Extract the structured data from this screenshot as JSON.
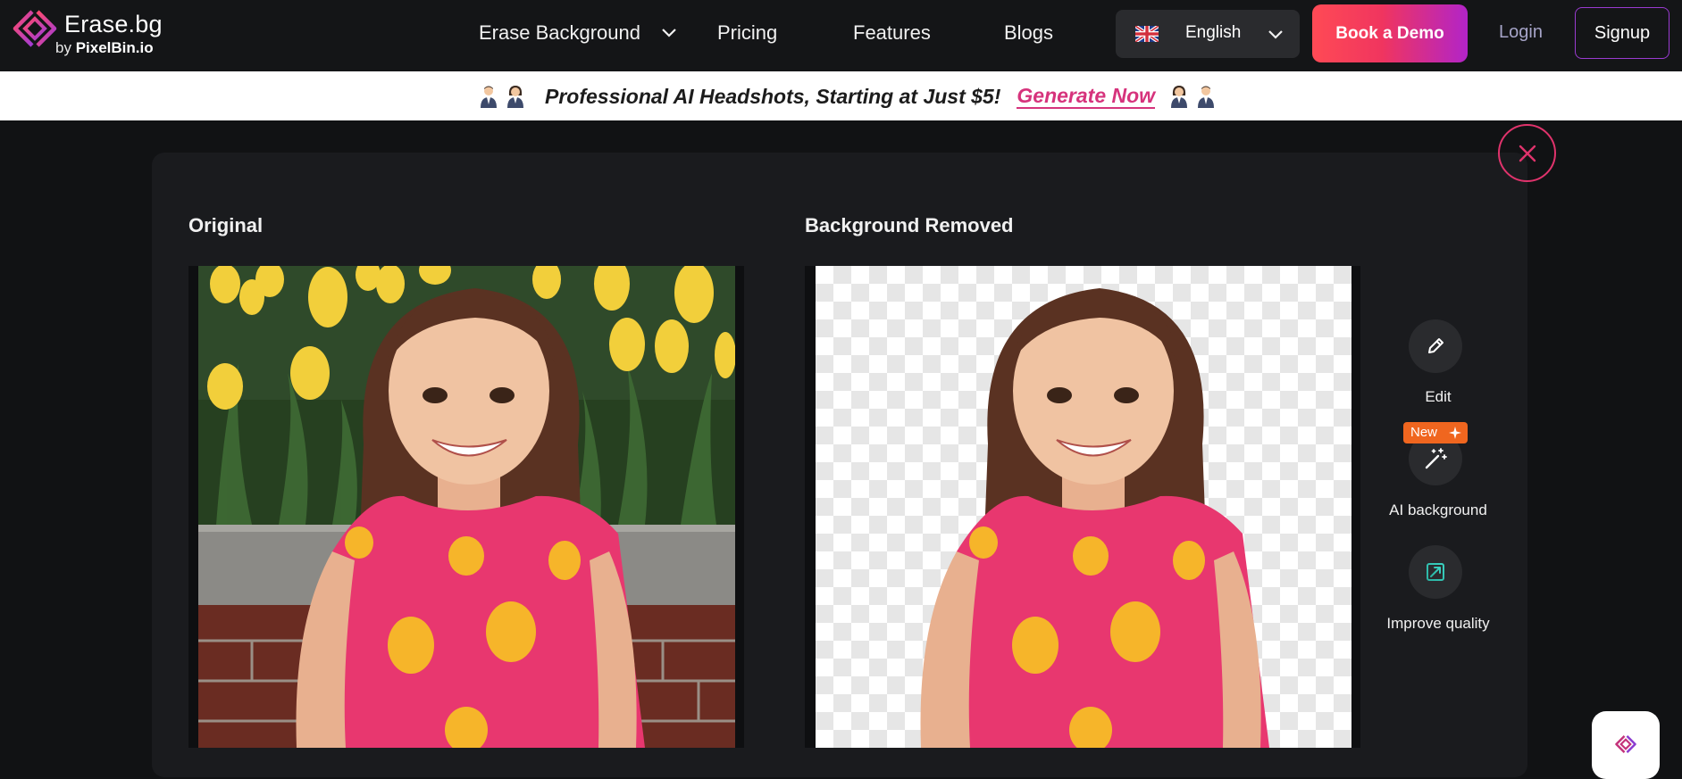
{
  "nav": {
    "brand_name": "Erase.bg",
    "brand_by_prefix": "by",
    "brand_by_name": "PixelBin.io",
    "links": [
      "Erase Background",
      "Pricing",
      "Features",
      "Blogs"
    ],
    "language": "English",
    "demo_label": "Book a Demo",
    "login_label": "Login",
    "signup_label": "Signup"
  },
  "banner": {
    "text": "Professional AI Headshots, Starting at Just $5!",
    "link": "Generate Now"
  },
  "result": {
    "original_title": "Original",
    "removed_title": "Background Removed"
  },
  "tools": {
    "edit_label": "Edit",
    "ai_bg_label": "AI background",
    "new_badge": "New",
    "improve_label": "Improve quality"
  },
  "colors": {
    "accent_pink": "#e0336c",
    "demo_gradient_start": "#ff4a55",
    "demo_gradient_end": "#b224c8",
    "badge_orange": "#f0661f",
    "banner_link": "#d6337c"
  },
  "icons": {
    "logo": "erase-bg-logo",
    "close": "close-icon",
    "edit": "pencil-icon",
    "ai_bg": "magic-wand-icon",
    "improve": "enhance-icon",
    "language_flag": "uk-flag-icon",
    "chevron": "chevron-down-icon"
  }
}
